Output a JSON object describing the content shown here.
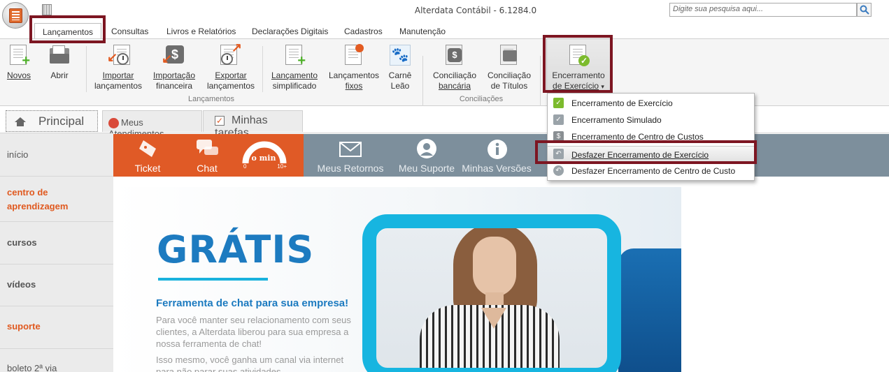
{
  "window": {
    "title": "Alterdata Contábil - 6.1284.0",
    "search_placeholder": "Digite sua pesquisa aqui..."
  },
  "ribbon_tabs": [
    "Lançamentos",
    "Consultas",
    "Livros e Relatórios",
    "Declarações Digitais",
    "Cadastros",
    "Manutenção"
  ],
  "ribbon_buttons": {
    "novos": "Novos",
    "abrir": "Abrir",
    "importar_l1": "Importar",
    "importar_l2": "lançamentos",
    "import_fin_l1": "Importação",
    "import_fin_l2": "financeira",
    "exportar_l1": "Exportar",
    "exportar_l2": "lançamentos",
    "lanc_simpl_l1": "Lançamento",
    "lanc_simpl_l2": "simplificado",
    "lanc_fixos_l1": "Lançamentos",
    "lanc_fixos_l2": "fixos",
    "carne_l1": "Carnê",
    "carne_l2": "Leão",
    "conc_banc_l1": "Conciliação",
    "conc_banc_l2": "bancária",
    "conc_tit_l1": "Conciliação",
    "conc_tit_l2": "de Títulos",
    "encerr_l1": "Encerramento",
    "encerr_l2": "de Exercício",
    "encerr_arrow": "▾"
  },
  "ribbon_groups": {
    "lancamentos": "Lançamentos",
    "conciliacoes": "Conciliações"
  },
  "dropdown_items": [
    "Encerramento de Exercício",
    "Encerramento Simulado",
    "Encerramento de Centro de Custos",
    "Desfazer Encerramento de Exercício",
    "Desfazer Encerramento de Centro de Custo"
  ],
  "doc_tabs": {
    "principal": "Principal",
    "atendimentos": "Meus Atendimentos",
    "tarefas": "Minhas tarefas"
  },
  "sidebar": {
    "inicio": "início",
    "centro_l1": "centro de",
    "centro_l2": "aprendizagem",
    "cursos": "cursos",
    "videos": "vídeos",
    "suporte": "suporte",
    "boleto": "boleto 2ª via"
  },
  "top_strip": {
    "ticket": "Ticket",
    "chat": "Chat",
    "gauge_value": "o min",
    "gauge_min": "0",
    "gauge_max": "10+",
    "retornos": "Meus Retornos",
    "suporte": "Meu Suporte",
    "versoes": "Minhas Versões"
  },
  "banner": {
    "headline": "GRÁTIS",
    "subtitle": "Ferramenta de chat para sua empresa!",
    "paragraph1": "Para você manter seu relacionamento com seus clientes, a Alterdata liberou para sua empresa a nossa ferramenta de chat!",
    "paragraph2": "Isso mesmo, você ganha um canal via internet para não parar suas atividades."
  },
  "colors": {
    "accent_orange": "#e05a26",
    "strip_gray": "#7d8f9c",
    "brand_blue": "#1d7bc0",
    "cyan": "#17b5e0",
    "highlight_box": "#7d1622"
  }
}
